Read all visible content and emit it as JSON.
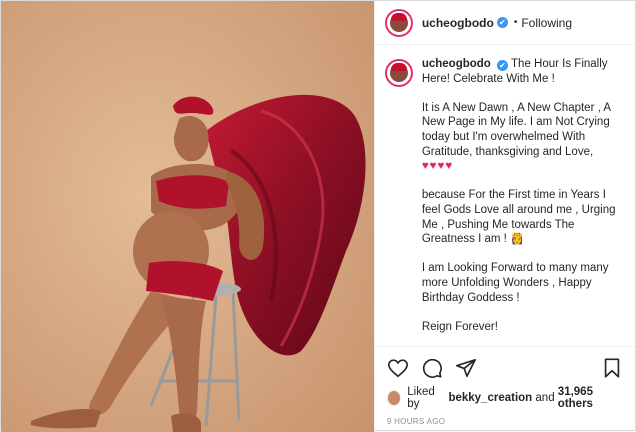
{
  "post": {
    "username": "ucheogbodo",
    "follow_status": "Following",
    "dot": "•",
    "verified_mark": "✔",
    "caption": {
      "line1": "The Hour Is Finally Here! Celebrate With Me !",
      "p2": "It is A New Dawn , A New Chapter , A New Page in My life. I am Not Crying today but I'm overwhelmed With Gratitude, thanksgiving and Love,",
      "p2_hearts": "♥♥♥♥",
      "p3": "because For the First time in Years I feel Gods Love all around me , Urging Me , Pushing Me towards The Greatness I am !",
      "p3_emoji": "👸",
      "p4": "I am Looking Forward to many many more Unfolding Wonders , Happy Birthday Goddess !",
      "p5": "Reign Forever!"
    },
    "likes": {
      "prefix": "Liked by",
      "user": "bekky_creation",
      "middle": "and",
      "count": "31,965 others"
    },
    "timestamp": "9 HOURS AGO",
    "icons": [
      "heart-icon",
      "comment-icon",
      "share-icon",
      "bookmark-icon"
    ]
  },
  "colors": {
    "background": "#d8ad86",
    "fabric": "#9b1328",
    "accent_verified": "#3897f0",
    "hearts": "#e0245e"
  }
}
